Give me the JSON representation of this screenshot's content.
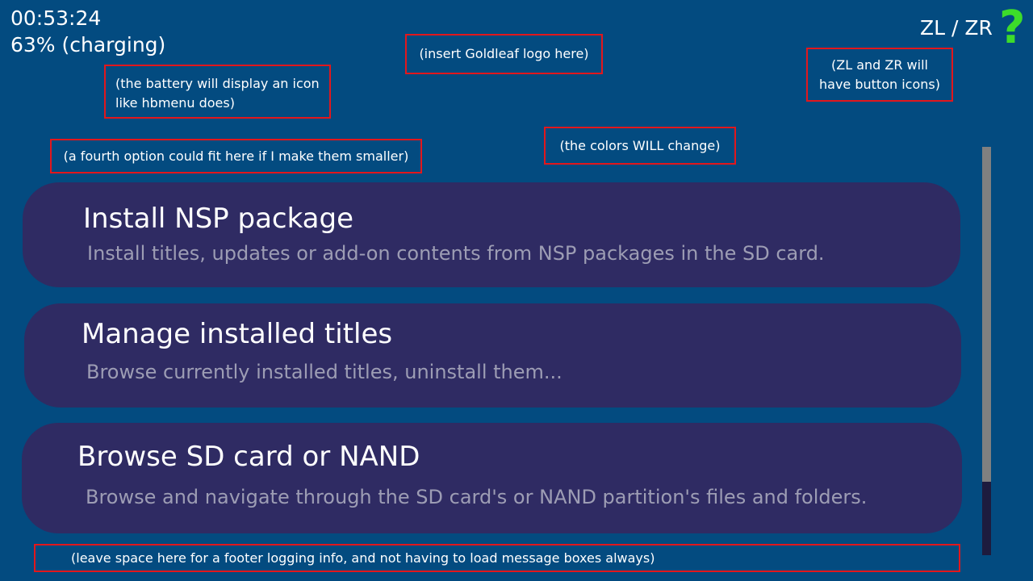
{
  "status": {
    "time": "00:53:24",
    "battery": "63% (charging)"
  },
  "header": {
    "shoulder_buttons": "ZL / ZR",
    "help_glyph": "?",
    "help_icon": "question-mark-icon",
    "help_color": "#3ddc2a"
  },
  "annotations": {
    "battery_note_line1": "(the battery will display an icon",
    "battery_note_line2": "like hbmenu does)",
    "logo_note": "(insert Goldleaf logo here)",
    "buttons_note_line1": "(ZL and ZR will",
    "buttons_note_line2": "have button icons)",
    "colors_note": "(the colors WILL change)",
    "fourth_option_note": "(a fourth option could fit here if I make them smaller)",
    "footer_note": "(leave space here for a footer logging info, and not having to load message boxes always)"
  },
  "menu": {
    "items": [
      {
        "title": "Install NSP package",
        "description": "Install titles, updates or add-on contents from NSP packages in the SD card."
      },
      {
        "title": "Manage installed titles",
        "description": "Browse currently installed titles, uninstall them..."
      },
      {
        "title": "Browse SD card or NAND",
        "description": "Browse and navigate through the SD card's or NAND partition's files and folders."
      }
    ]
  },
  "scroll": {
    "visible_fraction": 0.82
  },
  "colors": {
    "background": "#034b80",
    "menu_item": "#2f2b63",
    "annotation_border": "#e3171c",
    "description_text": "#9d9db4"
  }
}
